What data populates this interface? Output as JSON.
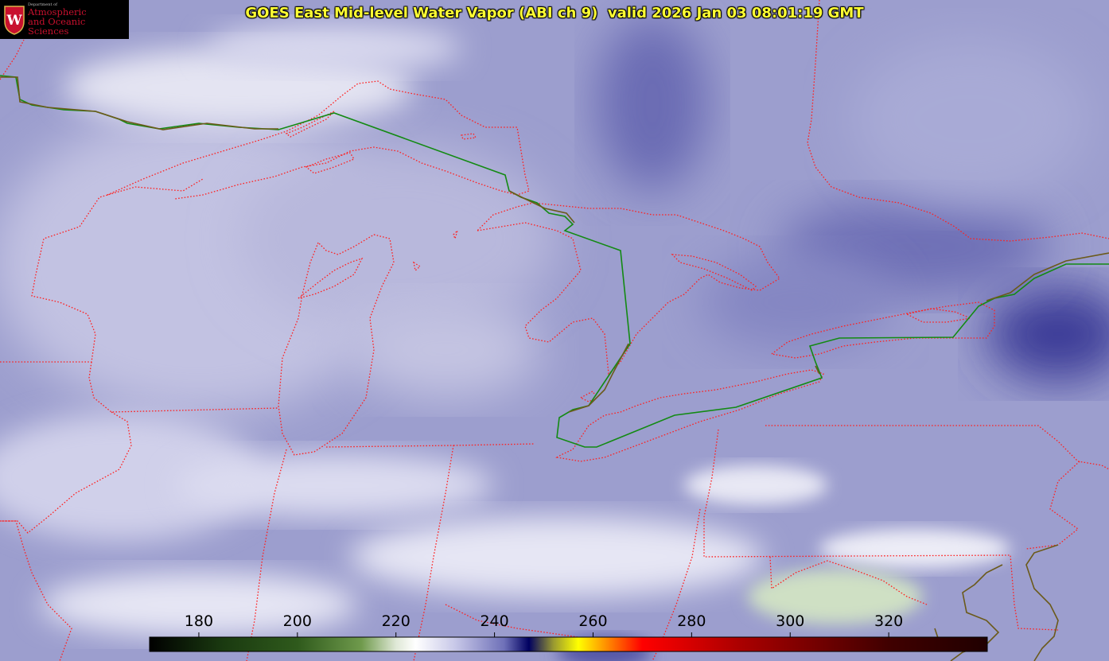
{
  "header": {
    "title": "GOES East Mid-level Water Vapor (ABI ch 9)  valid 2026 Jan 03 08:01:19 GMT"
  },
  "logo": {
    "line1": "Department of",
    "line2": "Atmospheric",
    "line3": "and Oceanic Sciences",
    "seal_letter": "W"
  },
  "colorbar": {
    "unit_range": [
      170,
      340
    ],
    "ticks": [
      "180",
      "200",
      "220",
      "240",
      "260",
      "280",
      "300",
      "320"
    ],
    "tick_values": [
      180,
      200,
      220,
      240,
      260,
      280,
      300,
      320
    ],
    "stops": [
      {
        "value": 170,
        "color": "#000000"
      },
      {
        "value": 185,
        "color": "#1a3a10"
      },
      {
        "value": 200,
        "color": "#2f5a1c"
      },
      {
        "value": 213,
        "color": "#6f9a4c"
      },
      {
        "value": 220,
        "color": "#dfe8d6"
      },
      {
        "value": 224,
        "color": "#ffffff"
      },
      {
        "value": 232,
        "color": "#c8c8e8"
      },
      {
        "value": 242,
        "color": "#6e70b8"
      },
      {
        "value": 247,
        "color": "#000060"
      },
      {
        "value": 252,
        "color": "#9a9a30"
      },
      {
        "value": 257,
        "color": "#ffff00"
      },
      {
        "value": 263,
        "color": "#ff8800"
      },
      {
        "value": 270,
        "color": "#ff0000"
      },
      {
        "value": 290,
        "color": "#aa0000"
      },
      {
        "value": 320,
        "color": "#400000"
      },
      {
        "value": 340,
        "color": "#200000"
      }
    ]
  },
  "colors": {
    "background": "#9a9ccc",
    "state_border": "#ff2020",
    "national_border": "#138a13",
    "coastline": "#6b5a1a",
    "title": "#ffff33"
  }
}
